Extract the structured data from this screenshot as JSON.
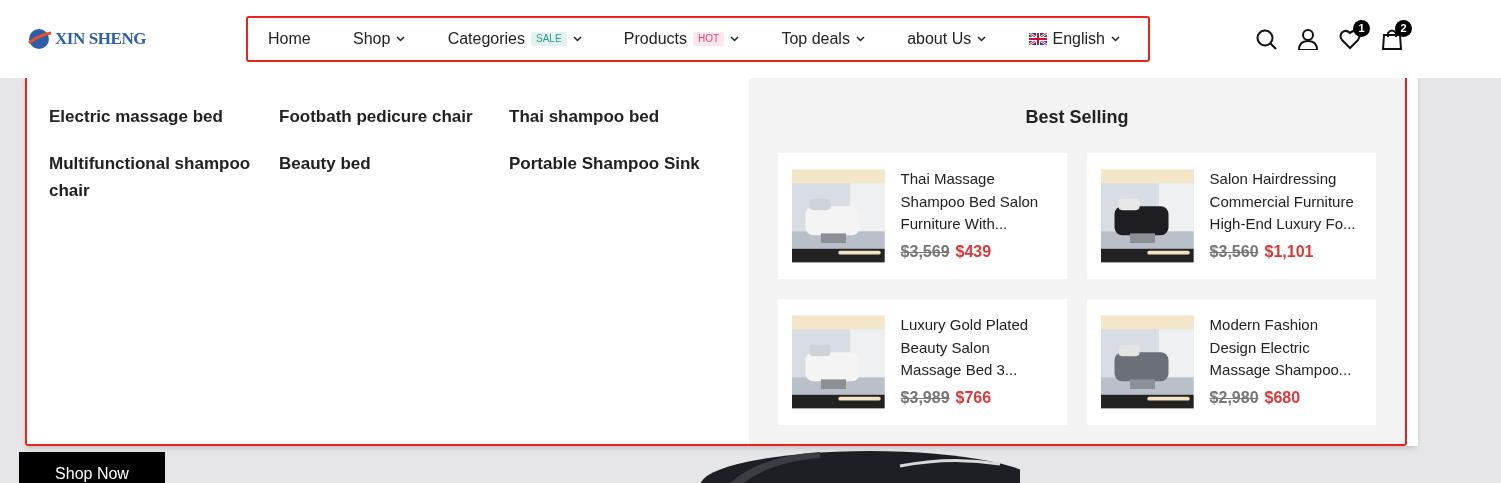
{
  "logo": {
    "text": "XIN SHENG"
  },
  "nav": [
    {
      "label": "Home",
      "dropdown": false
    },
    {
      "label": "Shop",
      "dropdown": true
    },
    {
      "label": "Categories",
      "dropdown": true,
      "badge": {
        "text": "SALE",
        "color": "#2a9d8f"
      }
    },
    {
      "label": "Products",
      "dropdown": true,
      "badge": {
        "text": "HOT",
        "color": "#e0457b"
      }
    },
    {
      "label": "Top deals",
      "dropdown": true
    },
    {
      "label": "about Us",
      "dropdown": true
    },
    {
      "label": "English",
      "dropdown": true,
      "kind": "language"
    }
  ],
  "header_icons": [
    {
      "kind": "search"
    },
    {
      "kind": "account"
    },
    {
      "kind": "wishlist",
      "count": "1"
    },
    {
      "kind": "cart",
      "count": "2"
    }
  ],
  "mega_menu": {
    "categories": [
      "Electric massage bed",
      "Footbath pedicure chair",
      "Thai shampoo bed",
      "Multifunctional shampoo chair",
      "Beauty bed",
      "Portable Shampoo Sink"
    ],
    "best_selling": {
      "title": "Best Selling",
      "products": [
        {
          "title": "Thai Massage Shampoo Bed Salon Furniture With...",
          "old_price": "$3,569",
          "price": "$439",
          "kind": "white"
        },
        {
          "title": "Salon Hairdressing Commercial Furniture High-End Luxury Fo...",
          "old_price": "$3,560",
          "price": "$1,101",
          "kind": "black"
        },
        {
          "title": "Luxury Gold Plated Beauty Salon Massage Bed 3...",
          "old_price": "$3,989",
          "price": "$766",
          "kind": "white"
        },
        {
          "title": "Modern Fashion Design Electric Massage Shampoo...",
          "old_price": "$2,980",
          "price": "$680",
          "kind": "grey"
        }
      ]
    }
  },
  "hero": {
    "button": "Shop Now"
  }
}
